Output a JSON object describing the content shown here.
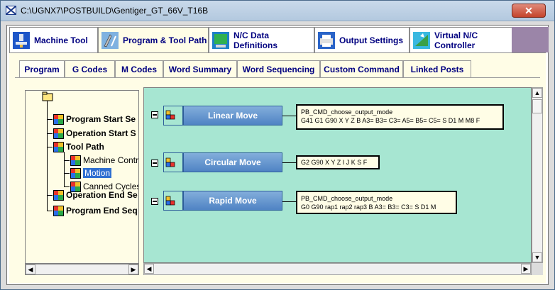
{
  "window": {
    "title": "C:\\UGNX7\\POSTBUILD\\Gentiger_GT_66V_T16B",
    "close_glyph": "✕"
  },
  "main_tabs": [
    {
      "label": "Machine Tool",
      "icon": "machine-tool-icon"
    },
    {
      "label": "Program & Tool Path",
      "icon": "program-tool-path-icon",
      "active": true
    },
    {
      "label": "N/C Data Definitions",
      "icon": "nc-data-icon"
    },
    {
      "label": "Output Settings",
      "icon": "output-settings-icon"
    },
    {
      "label": "Virtual N/C Controller",
      "icon": "virtual-controller-icon"
    }
  ],
  "sub_tabs": [
    {
      "label": "Program",
      "active": true
    },
    {
      "label": "G Codes"
    },
    {
      "label": "M Codes"
    },
    {
      "label": "Word Summary"
    },
    {
      "label": "Word Sequencing"
    },
    {
      "label": "Custom Command"
    },
    {
      "label": "Linked Posts"
    }
  ],
  "tree": {
    "items": [
      {
        "label": "Program Start Se"
      },
      {
        "label": "Operation Start S"
      },
      {
        "label": "Tool Path"
      },
      {
        "label": "Machine Contr"
      },
      {
        "label": "Motion",
        "selected": true
      },
      {
        "label": "Canned Cycles"
      },
      {
        "label": "Operation End Se"
      },
      {
        "label": "Program End Seq"
      }
    ]
  },
  "events": [
    {
      "label": "Linear Move",
      "lines": [
        "PB_CMD_choose_output_mode",
        "G41 G1 G90 X Y Z B A3= B3= C3= A5= B5= C5= S D1 M M8 F"
      ]
    },
    {
      "label": "Circular Move",
      "lines": [
        "G2 G90 X Y Z I J K S F"
      ]
    },
    {
      "label": "Rapid Move",
      "lines": [
        "PB_CMD_choose_output_mode",
        "G0 G90 rap1 rap2 rap3 B A3= B3= C3= S D1 M"
      ]
    }
  ],
  "colors": {
    "canvas": "#a7e6d2",
    "panel": "#fffde6",
    "tab_text": "#000080",
    "event_button": "#4f83c4"
  }
}
